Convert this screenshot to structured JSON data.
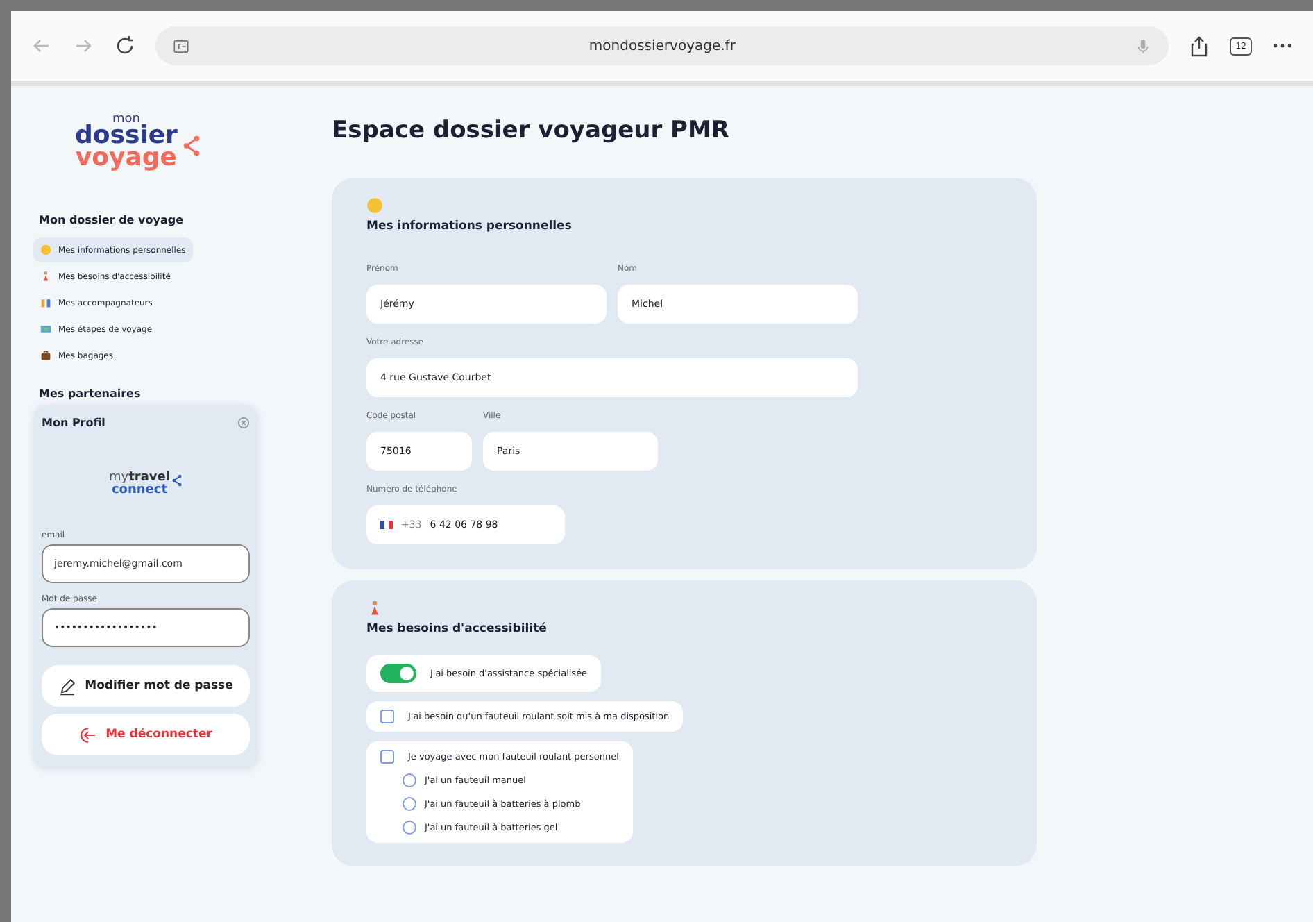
{
  "browser": {
    "url": "mondossiervoyage.fr",
    "tab_count": "12"
  },
  "logo": {
    "small": "mon",
    "line1": "dossier",
    "line2": "voyage"
  },
  "sidebar": {
    "heading": "Mon dossier de voyage",
    "items": [
      {
        "label": "Mes informations personnelles",
        "selected": true,
        "kind": "face"
      },
      {
        "label": "Mes besoins d'accessibilité",
        "selected": false,
        "kind": "person"
      },
      {
        "label": "Mes accompagnateurs",
        "selected": false,
        "kind": "people"
      },
      {
        "label": "Mes étapes de voyage",
        "selected": false,
        "kind": "map"
      },
      {
        "label": "Mes bagages",
        "selected": false,
        "kind": "bag"
      }
    ],
    "partners_heading": "Mes partenaires"
  },
  "profile": {
    "title": "Mon Profil",
    "partner_logo": {
      "part1": "my",
      "part2": "travel",
      "part3": "connect"
    },
    "email_label": "email",
    "email": "jeremy.michel@gmail.com",
    "password_label": "Mot de passe",
    "password": "••••••••••••••••••",
    "change_password": "Modifier mot de passe",
    "logout": "Me déconnecter"
  },
  "page_title": "Espace dossier voyageur PMR",
  "personal": {
    "title": "Mes informations personnelles",
    "fields": [
      {
        "label": "Prénom",
        "value": "Jérémy",
        "kind": "half"
      },
      {
        "label": "Nom",
        "value": "Michel",
        "kind": "half"
      },
      {
        "label": "Votre adresse",
        "value": "4 rue Gustave Courbet",
        "kind": "full"
      },
      {
        "label": "Code postal",
        "value": "75016",
        "kind": "small"
      },
      {
        "label": "Ville",
        "value": "Paris",
        "kind": "mid"
      },
      {
        "label": "Numéro de téléphone",
        "prefix": "+33",
        "value": "6 42 06 78 98",
        "kind": "phone"
      }
    ]
  },
  "accessibility": {
    "title": "Mes besoins d'accessibilité",
    "options": [
      {
        "kind": "toggle",
        "label": "J'ai besoin d'assistance spécialisée",
        "on": true
      },
      {
        "kind": "checkbox",
        "label": "J'ai besoin qu'un fauteuil roulant soit mis à ma disposition",
        "checked": false
      },
      {
        "kind": "checkbox",
        "label": "Je voyage avec mon fauteuil roulant personnel",
        "checked": false,
        "choices": [
          {
            "label": "J'ai un fauteuil manuel",
            "selected": false
          },
          {
            "label": "J'ai un fauteuil à batteries à plomb",
            "selected": false
          },
          {
            "label": "J'ai un fauteuil à batteries gel",
            "selected": false
          }
        ]
      }
    ]
  }
}
